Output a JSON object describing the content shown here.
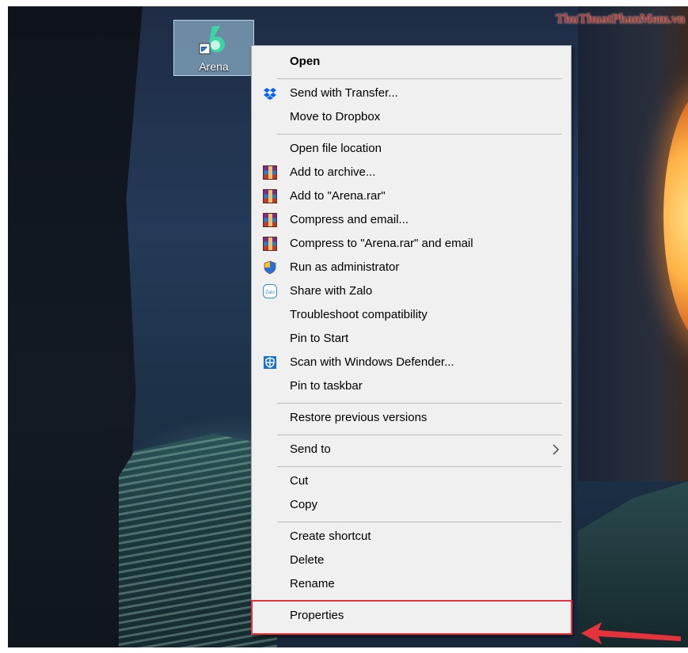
{
  "watermark": "ThuThuatPhanMem.vn",
  "desktop_icon": {
    "label": "Arena",
    "icon": "arena-app-icon"
  },
  "menu": {
    "open": "Open",
    "send_with_transfer": "Send with Transfer...",
    "move_to_dropbox": "Move to Dropbox",
    "open_file_location": "Open file location",
    "add_to_archive": "Add to archive...",
    "add_to_arena_rar": "Add to \"Arena.rar\"",
    "compress_and_email": "Compress and email...",
    "compress_to_arena_rar_email": "Compress to \"Arena.rar\" and email",
    "run_as_admin": "Run as administrator",
    "share_with_zalo": "Share with Zalo",
    "troubleshoot": "Troubleshoot compatibility",
    "pin_to_start": "Pin to Start",
    "scan_defender": "Scan with Windows Defender...",
    "pin_to_taskbar": "Pin to taskbar",
    "restore_versions": "Restore previous versions",
    "send_to": "Send to",
    "cut": "Cut",
    "copy": "Copy",
    "create_shortcut": "Create shortcut",
    "delete": "Delete",
    "rename": "Rename",
    "properties": "Properties",
    "zalo_icon_text": "Zalo"
  },
  "colors": {
    "highlight": "#e5333b",
    "dropbox": "#0061fe",
    "defender": "#1a73c9"
  }
}
